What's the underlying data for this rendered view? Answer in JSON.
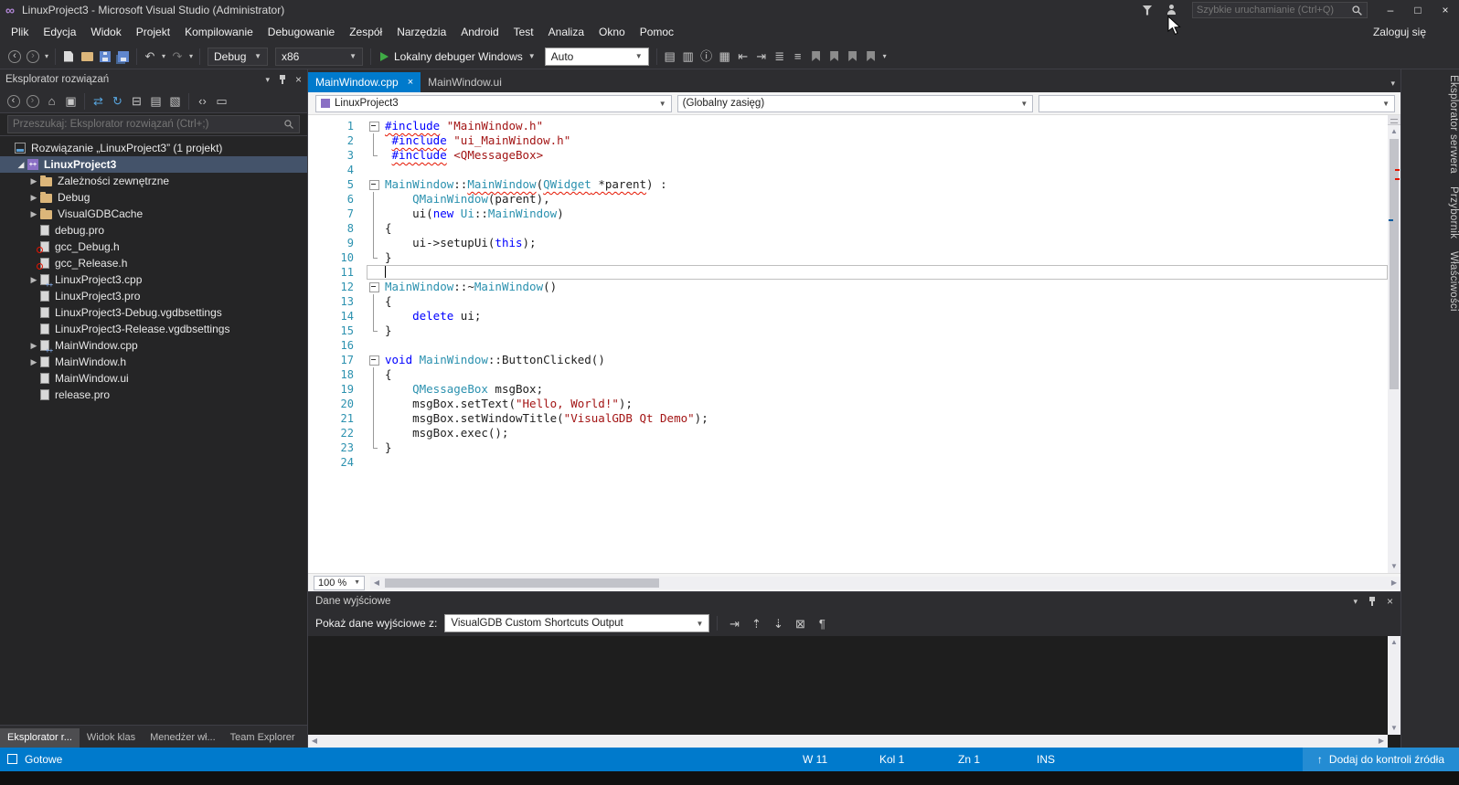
{
  "colors": {
    "accent_blue": "#007acc",
    "selection_row": "#44536a",
    "keyword": "#0000ff",
    "string": "#a31515",
    "type": "#2b91af",
    "error_squiggle": "#e51400"
  },
  "window": {
    "title": "LinuxProject3 - Microsoft Visual Studio (Administrator)",
    "quick_launch_placeholder": "Szybkie uruchamianie (Ctrl+Q)",
    "minimize": "–",
    "maximize": "□",
    "close": "×",
    "logo_glyph": "∞"
  },
  "menu": {
    "items": [
      "Plik",
      "Edycja",
      "Widok",
      "Projekt",
      "Kompilowanie",
      "Debugowanie",
      "Zespół",
      "Narzędzia",
      "Android",
      "Test",
      "Analiza",
      "Okno",
      "Pomoc"
    ],
    "sign_in": "Zaloguj się"
  },
  "toolbar": {
    "left_icons": [
      {
        "name": "navigate-back-icon",
        "glyph": "‹",
        "circle": true
      },
      {
        "name": "navigate-forward-icon",
        "glyph": "›",
        "circle": true,
        "dim": true
      },
      {
        "name": "navigation-dropdown-icon",
        "glyph": "▾",
        "tiny": true
      },
      {
        "name": "sep"
      },
      {
        "name": "new-file-icon",
        "style": "page"
      },
      {
        "name": "open-file-icon",
        "style": "folderopen"
      },
      {
        "name": "save-icon",
        "style": "save"
      },
      {
        "name": "save-all-icon",
        "style": "saveall"
      },
      {
        "name": "sep"
      },
      {
        "name": "undo-icon",
        "glyph": "↶"
      },
      {
        "name": "undo-dropdown-icon",
        "glyph": "▾",
        "tiny": true
      },
      {
        "name": "redo-icon",
        "glyph": "↷",
        "dim": true
      },
      {
        "name": "redo-dropdown-icon",
        "glyph": "▾",
        "tiny": true
      },
      {
        "name": "sep"
      }
    ],
    "config_value": "Debug",
    "platform_value": "x86",
    "start_label": "Lokalny debuger Windows",
    "watch_value": "Auto",
    "right_icons": [
      {
        "name": "member-list-icon",
        "glyph": "▤"
      },
      {
        "name": "parameter-info-icon",
        "glyph": "▥"
      },
      {
        "name": "quick-info-icon",
        "glyph": "ⓘ"
      },
      {
        "name": "word-completion-icon",
        "glyph": "▦"
      },
      {
        "name": "decrease-indent-icon",
        "glyph": "⇤"
      },
      {
        "name": "increase-indent-icon",
        "glyph": "⇥"
      },
      {
        "name": "comment-icon",
        "glyph": "≣"
      },
      {
        "name": "uncomment-icon",
        "glyph": "≡"
      },
      {
        "name": "toggle-bookmark-icon",
        "style": "flag"
      },
      {
        "name": "previous-bookmark-icon",
        "style": "flag"
      },
      {
        "name": "next-bookmark-icon",
        "style": "flag"
      },
      {
        "name": "clear-bookmarks-icon",
        "style": "flag"
      },
      {
        "name": "toolbar-overflow-icon",
        "glyph": "▾",
        "tiny": true
      }
    ]
  },
  "solution_explorer": {
    "title": "Eksplorator rozwiązań",
    "search_placeholder": "Przeszukaj: Eksplorator rozwiązań (Ctrl+;)",
    "toolbar_icons": [
      {
        "name": "explorer-back-icon",
        "glyph": "‹",
        "circle": true
      },
      {
        "name": "explorer-forward-icon",
        "glyph": "›",
        "circle": true,
        "dim": true
      },
      {
        "name": "home-icon",
        "glyph": "⌂"
      },
      {
        "name": "scope-icon",
        "glyph": "▣"
      },
      {
        "name": "sep"
      },
      {
        "name": "sync-active-document-icon",
        "glyph": "⇄",
        "blue": true
      },
      {
        "name": "refresh-icon",
        "glyph": "↻",
        "blue": true
      },
      {
        "name": "collapse-all-icon",
        "glyph": "⊟"
      },
      {
        "name": "show-all-files-icon",
        "glyph": "▤"
      },
      {
        "name": "properties-icon",
        "glyph": "▧"
      },
      {
        "name": "sep"
      },
      {
        "name": "view-code-icon",
        "glyph": "‹›"
      },
      {
        "name": "preview-icon",
        "glyph": "▭"
      }
    ],
    "tree": [
      {
        "label": "Rozwiązanie „LinuxProject3” (1 projekt)",
        "depth": 0,
        "icon": "solution-icon",
        "arrow": "none"
      },
      {
        "label": "LinuxProject3",
        "depth": 1,
        "icon": "project-icon",
        "arrow": "expanded",
        "selected": true,
        "bold": true
      },
      {
        "label": "Zależności zewnętrzne",
        "depth": 2,
        "icon": "folder-icon",
        "arrow": "collapsed"
      },
      {
        "label": "Debug",
        "depth": 2,
        "icon": "folder-icon",
        "arrow": "collapsed"
      },
      {
        "label": "VisualGDBCache",
        "depth": 2,
        "icon": "folder-icon",
        "arrow": "collapsed"
      },
      {
        "label": "debug.pro",
        "depth": 2,
        "icon": "file-icon",
        "arrow": "none"
      },
      {
        "label": "gcc_Debug.h",
        "depth": 2,
        "icon": "excluded-header-icon",
        "arrow": "none"
      },
      {
        "label": "gcc_Release.h",
        "depth": 2,
        "icon": "excluded-header-icon",
        "arrow": "none"
      },
      {
        "label": "LinuxProject3.cpp",
        "depth": 2,
        "icon": "cpp-file-icon",
        "arrow": "collapsed"
      },
      {
        "label": "LinuxProject3.pro",
        "depth": 2,
        "icon": "file-icon",
        "arrow": "none"
      },
      {
        "label": "LinuxProject3-Debug.vgdbsettings",
        "depth": 2,
        "icon": "file-icon",
        "arrow": "none"
      },
      {
        "label": "LinuxProject3-Release.vgdbsettings",
        "depth": 2,
        "icon": "file-icon",
        "arrow": "none"
      },
      {
        "label": "MainWindow.cpp",
        "depth": 2,
        "icon": "cpp-file-icon",
        "arrow": "collapsed"
      },
      {
        "label": "MainWindow.h",
        "depth": 2,
        "icon": "header-file-icon",
        "arrow": "collapsed"
      },
      {
        "label": "MainWindow.ui",
        "depth": 2,
        "icon": "file-icon",
        "arrow": "none"
      },
      {
        "label": "release.pro",
        "depth": 2,
        "icon": "file-icon",
        "arrow": "none"
      }
    ],
    "bottom_tabs": [
      {
        "label": "Eksplorator r...",
        "active": true
      },
      {
        "label": "Widok klas",
        "active": false
      },
      {
        "label": "Menedżer wł...",
        "active": false
      },
      {
        "label": "Team Explorer",
        "active": false
      }
    ]
  },
  "editor": {
    "tabs": [
      {
        "label": "MainWindow.cpp",
        "active": true,
        "closable": true
      },
      {
        "label": "MainWindow.ui",
        "active": false,
        "closable": false
      }
    ],
    "nav": {
      "project": "LinuxProject3",
      "scope": "(Globalny zasięg)",
      "member": ""
    },
    "zoom": "100 %",
    "code": {
      "lines": [
        {
          "n": 1,
          "fold": "start",
          "tokens": [
            {
              "c": "pp",
              "t": "#include",
              "sq": true
            },
            {
              "c": "pl",
              "t": " "
            },
            {
              "c": "str",
              "t": "\"MainWindow.h\""
            }
          ]
        },
        {
          "n": 2,
          "fold": "mid",
          "tokens": [
            {
              "c": "pl",
              "t": " "
            },
            {
              "c": "pp",
              "t": "#include",
              "sq": true
            },
            {
              "c": "pl",
              "t": " "
            },
            {
              "c": "str",
              "t": "\"ui_MainWindow.h\""
            }
          ]
        },
        {
          "n": 3,
          "fold": "end",
          "tokens": [
            {
              "c": "pl",
              "t": " "
            },
            {
              "c": "pp",
              "t": "#include",
              "sq": true
            },
            {
              "c": "pl",
              "t": " "
            },
            {
              "c": "str",
              "t": "<QMessageBox>"
            }
          ]
        },
        {
          "n": 4,
          "fold": "",
          "tokens": []
        },
        {
          "n": 5,
          "fold": "start",
          "tokens": [
            {
              "c": "ty",
              "t": "MainWindow"
            },
            {
              "c": "pl",
              "t": "::"
            },
            {
              "c": "ty",
              "t": "MainWindow",
              "sq": true
            },
            {
              "c": "pl",
              "t": "("
            },
            {
              "c": "ty",
              "t": "QWidget",
              "sq": true
            },
            {
              "c": "pl",
              "t": " *parent",
              "sq": true
            },
            {
              "c": "pl",
              "t": ") "
            },
            {
              "c": "pl",
              "t": ":"
            }
          ]
        },
        {
          "n": 6,
          "fold": "mid",
          "tokens": [
            {
              "c": "pl",
              "t": "    "
            },
            {
              "c": "ty",
              "t": "QMainWindow"
            },
            {
              "c": "pl",
              "t": "(parent),"
            }
          ]
        },
        {
          "n": 7,
          "fold": "mid",
          "tokens": [
            {
              "c": "pl",
              "t": "    ui("
            },
            {
              "c": "kw",
              "t": "new"
            },
            {
              "c": "pl",
              "t": " "
            },
            {
              "c": "ty",
              "t": "Ui"
            },
            {
              "c": "pl",
              "t": "::"
            },
            {
              "c": "ty",
              "t": "MainWindow"
            },
            {
              "c": "pl",
              "t": ")"
            }
          ]
        },
        {
          "n": 8,
          "fold": "mid",
          "tokens": [
            {
              "c": "pl",
              "t": "{"
            }
          ]
        },
        {
          "n": 9,
          "fold": "mid",
          "tokens": [
            {
              "c": "pl",
              "t": "    ui->setupUi("
            },
            {
              "c": "kw",
              "t": "this"
            },
            {
              "c": "pl",
              "t": ");"
            }
          ]
        },
        {
          "n": 10,
          "fold": "end",
          "tokens": [
            {
              "c": "pl",
              "t": "}"
            }
          ]
        },
        {
          "n": 11,
          "fold": "",
          "tokens": [],
          "current": true
        },
        {
          "n": 12,
          "fold": "start",
          "tokens": [
            {
              "c": "ty",
              "t": "MainWindow"
            },
            {
              "c": "pl",
              "t": "::~"
            },
            {
              "c": "ty",
              "t": "MainWindow"
            },
            {
              "c": "pl",
              "t": "()"
            }
          ]
        },
        {
          "n": 13,
          "fold": "mid",
          "tokens": [
            {
              "c": "pl",
              "t": "{"
            }
          ]
        },
        {
          "n": 14,
          "fold": "mid",
          "tokens": [
            {
              "c": "pl",
              "t": "    "
            },
            {
              "c": "kw",
              "t": "delete"
            },
            {
              "c": "pl",
              "t": " ui;"
            }
          ]
        },
        {
          "n": 15,
          "fold": "end",
          "tokens": [
            {
              "c": "pl",
              "t": "}"
            }
          ]
        },
        {
          "n": 16,
          "fold": "",
          "tokens": []
        },
        {
          "n": 17,
          "fold": "start",
          "tokens": [
            {
              "c": "kw",
              "t": "void"
            },
            {
              "c": "pl",
              "t": " "
            },
            {
              "c": "ty",
              "t": "MainWindow"
            },
            {
              "c": "pl",
              "t": "::ButtonClicked()"
            }
          ]
        },
        {
          "n": 18,
          "fold": "mid",
          "tokens": [
            {
              "c": "pl",
              "t": "{"
            }
          ]
        },
        {
          "n": 19,
          "fold": "mid",
          "tokens": [
            {
              "c": "pl",
              "t": "    "
            },
            {
              "c": "ty",
              "t": "QMessageBox"
            },
            {
              "c": "pl",
              "t": " msgBox;"
            }
          ]
        },
        {
          "n": 20,
          "fold": "mid",
          "tokens": [
            {
              "c": "pl",
              "t": "    msgBox.setText("
            },
            {
              "c": "str",
              "t": "\"Hello, World!\""
            },
            {
              "c": "pl",
              "t": ");"
            }
          ]
        },
        {
          "n": 21,
          "fold": "mid",
          "tokens": [
            {
              "c": "pl",
              "t": "    msgBox.setWindowTitle("
            },
            {
              "c": "str",
              "t": "\"VisualGDB Qt Demo\""
            },
            {
              "c": "pl",
              "t": ");"
            }
          ]
        },
        {
          "n": 22,
          "fold": "mid",
          "tokens": [
            {
              "c": "pl",
              "t": "    msgBox.exec();"
            }
          ]
        },
        {
          "n": 23,
          "fold": "end",
          "tokens": [
            {
              "c": "pl",
              "t": "}"
            }
          ]
        },
        {
          "n": 24,
          "fold": "",
          "tokens": []
        }
      ]
    }
  },
  "output": {
    "title": "Dane wyjściowe",
    "show_label": "Pokaż dane wyjściowe z:",
    "source_value": "VisualGDB Custom Shortcuts Output",
    "icons": [
      {
        "name": "goto-message-icon",
        "glyph": "⇥"
      },
      {
        "name": "previous-message-icon",
        "glyph": "⇡"
      },
      {
        "name": "next-message-icon",
        "glyph": "⇣"
      },
      {
        "name": "clear-all-icon",
        "glyph": "⊠"
      },
      {
        "name": "word-wrap-icon",
        "glyph": "¶"
      }
    ]
  },
  "right_tabs": [
    "Eksplorator serwera",
    "Przybornik",
    "Właściwości"
  ],
  "status_bar": {
    "state": "Gotowe",
    "line": "W 11",
    "column": "Kol 1",
    "character": "Zn 1",
    "mode": "INS",
    "source_control": "Dodaj do kontroli źródła"
  }
}
